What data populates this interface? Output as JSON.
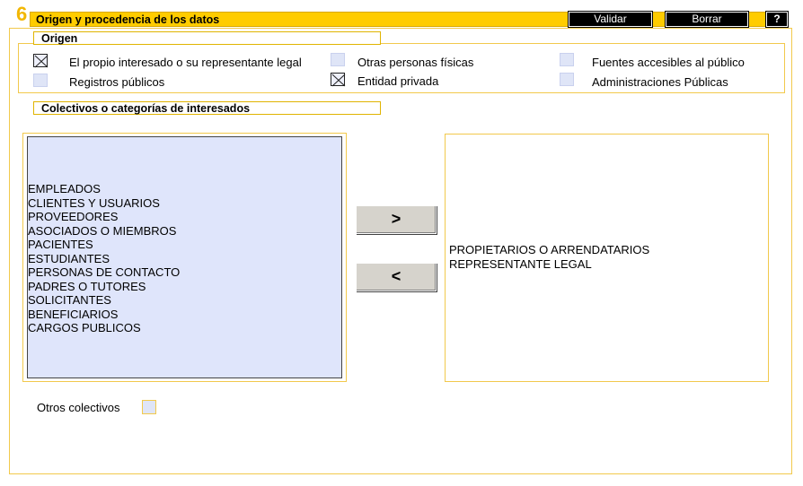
{
  "header": {
    "section_number": "6",
    "title": "Origen y procedencia de los datos",
    "validar_label": "Validar",
    "borrar_label": "Borrar",
    "help_label": "?"
  },
  "origen": {
    "legend": "Origen",
    "options": [
      {
        "label": "El propio interesado o su representante legal",
        "checked": true
      },
      {
        "label": "Registros públicos",
        "checked": false
      },
      {
        "label": "Otras personas físicas",
        "checked": false
      },
      {
        "label": "Entidad privada",
        "checked": true
      },
      {
        "label": "Fuentes accesibles al público",
        "checked": false
      },
      {
        "label": "Administraciones Públicas",
        "checked": false
      }
    ]
  },
  "colectivos": {
    "legend": "Colectivos o categorías de interesados",
    "available": [
      "EMPLEADOS",
      "CLIENTES Y USUARIOS",
      "PROVEEDORES",
      "ASOCIADOS O MIEMBROS",
      "PACIENTES",
      "ESTUDIANTES",
      "PERSONAS DE CONTACTO",
      "PADRES O TUTORES",
      "SOLICITANTES",
      "BENEFICIARIOS",
      "CARGOS PUBLICOS"
    ],
    "selected": [
      "PROPIETARIOS O ARRENDATARIOS",
      "REPRESENTANTE LEGAL"
    ],
    "move_right_label": ">",
    "move_left_label": "<"
  },
  "otros": {
    "label": "Otros colectivos",
    "checked": false
  },
  "colors": {
    "accent": "#ffcc00",
    "section_number": "#f2b705",
    "border": "#f2c94c",
    "list_bg": "#dfe5fb"
  }
}
